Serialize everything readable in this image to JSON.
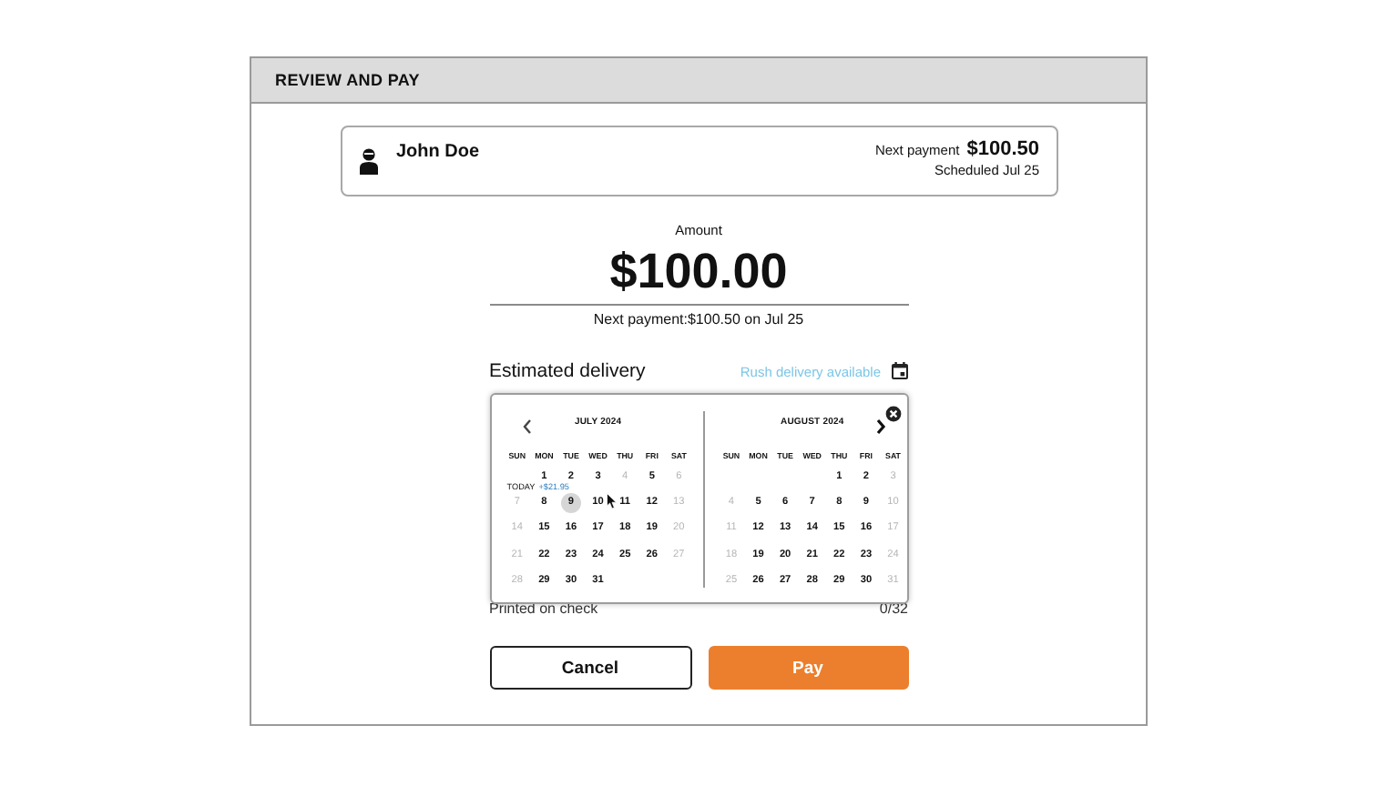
{
  "header": {
    "title": "REVIEW AND PAY"
  },
  "payee": {
    "name": "John Doe",
    "next_payment_label": "Next payment",
    "next_payment_amount": "$100.50",
    "scheduled": "Scheduled Jul 25"
  },
  "amount": {
    "label": "Amount",
    "value": "$100.00",
    "note": "Next payment:$100.50 on Jul 25"
  },
  "delivery": {
    "label": "Estimated delivery",
    "rush_link": "Rush delivery available"
  },
  "calendar": {
    "months": [
      {
        "title": "JULY 2024",
        "weekdays": [
          "SUN",
          "MON",
          "TUE",
          "WED",
          "THU",
          "FRI",
          "SAT"
        ],
        "weeks": [
          [
            {
              "kind": "blank"
            },
            {
              "kind": "day",
              "text": "1",
              "muted": false,
              "selected": false,
              "note_label": "TODAY",
              "note_amount": "+$21.95"
            },
            {
              "kind": "day",
              "text": "2",
              "muted": false,
              "selected": false
            },
            {
              "kind": "day",
              "text": "3",
              "muted": false,
              "selected": false
            },
            {
              "kind": "day",
              "text": "4",
              "muted": true,
              "selected": false
            },
            {
              "kind": "day",
              "text": "5",
              "muted": false,
              "selected": false
            },
            {
              "kind": "day",
              "text": "6",
              "muted": true,
              "selected": false
            }
          ],
          [
            {
              "kind": "day",
              "text": "7",
              "muted": true,
              "selected": false
            },
            {
              "kind": "day",
              "text": "8",
              "muted": false,
              "selected": false
            },
            {
              "kind": "day",
              "text": "9",
              "muted": false,
              "selected": true
            },
            {
              "kind": "day",
              "text": "10",
              "muted": false,
              "selected": false
            },
            {
              "kind": "day",
              "text": "11",
              "muted": false,
              "selected": false
            },
            {
              "kind": "day",
              "text": "12",
              "muted": false,
              "selected": false
            },
            {
              "kind": "day",
              "text": "13",
              "muted": true,
              "selected": false
            }
          ],
          [
            {
              "kind": "day",
              "text": "14",
              "muted": true,
              "selected": false
            },
            {
              "kind": "day",
              "text": "15",
              "muted": false,
              "selected": false
            },
            {
              "kind": "day",
              "text": "16",
              "muted": false,
              "selected": false
            },
            {
              "kind": "day",
              "text": "17",
              "muted": false,
              "selected": false
            },
            {
              "kind": "day",
              "text": "18",
              "muted": false,
              "selected": false
            },
            {
              "kind": "day",
              "text": "19",
              "muted": false,
              "selected": false
            },
            {
              "kind": "day",
              "text": "20",
              "muted": true,
              "selected": false
            }
          ],
          [
            {
              "kind": "day",
              "text": "21",
              "muted": true,
              "selected": false
            },
            {
              "kind": "day",
              "text": "22",
              "muted": false,
              "selected": false
            },
            {
              "kind": "day",
              "text": "23",
              "muted": false,
              "selected": false
            },
            {
              "kind": "day",
              "text": "24",
              "muted": false,
              "selected": false
            },
            {
              "kind": "day",
              "text": "25",
              "muted": false,
              "selected": false
            },
            {
              "kind": "day",
              "text": "26",
              "muted": false,
              "selected": false
            },
            {
              "kind": "day",
              "text": "27",
              "muted": true,
              "selected": false
            }
          ],
          [
            {
              "kind": "day",
              "text": "28",
              "muted": true,
              "selected": false
            },
            {
              "kind": "day",
              "text": "29",
              "muted": false,
              "selected": false
            },
            {
              "kind": "day",
              "text": "30",
              "muted": false,
              "selected": false
            },
            {
              "kind": "day",
              "text": "31",
              "muted": false,
              "selected": false
            }
          ]
        ]
      },
      {
        "title": "AUGUST 2024",
        "weekdays": [
          "SUN",
          "MON",
          "TUE",
          "WED",
          "THU",
          "FRI",
          "SAT"
        ],
        "weeks": [
          [
            {
              "kind": "blank"
            },
            {
              "kind": "blank"
            },
            {
              "kind": "blank"
            },
            {
              "kind": "blank"
            },
            {
              "kind": "day",
              "text": "1",
              "muted": false,
              "selected": false
            },
            {
              "kind": "day",
              "text": "2",
              "muted": false,
              "selected": false
            },
            {
              "kind": "day",
              "text": "3",
              "muted": true,
              "selected": false
            }
          ],
          [
            {
              "kind": "day",
              "text": "4",
              "muted": true,
              "selected": false
            },
            {
              "kind": "day",
              "text": "5",
              "muted": false,
              "selected": false
            },
            {
              "kind": "day",
              "text": "6",
              "muted": false,
              "selected": false
            },
            {
              "kind": "day",
              "text": "7",
              "muted": false,
              "selected": false
            },
            {
              "kind": "day",
              "text": "8",
              "muted": false,
              "selected": false
            },
            {
              "kind": "day",
              "text": "9",
              "muted": false,
              "selected": false
            },
            {
              "kind": "day",
              "text": "10",
              "muted": true,
              "selected": false
            }
          ],
          [
            {
              "kind": "day",
              "text": "11",
              "muted": true,
              "selected": false
            },
            {
              "kind": "day",
              "text": "12",
              "muted": false,
              "selected": false
            },
            {
              "kind": "day",
              "text": "13",
              "muted": false,
              "selected": false
            },
            {
              "kind": "day",
              "text": "14",
              "muted": false,
              "selected": false
            },
            {
              "kind": "day",
              "text": "15",
              "muted": false,
              "selected": false
            },
            {
              "kind": "day",
              "text": "16",
              "muted": false,
              "selected": false
            },
            {
              "kind": "day",
              "text": "17",
              "muted": true,
              "selected": false
            }
          ],
          [
            {
              "kind": "day",
              "text": "18",
              "muted": true,
              "selected": false
            },
            {
              "kind": "day",
              "text": "19",
              "muted": false,
              "selected": false
            },
            {
              "kind": "day",
              "text": "20",
              "muted": false,
              "selected": false
            },
            {
              "kind": "day",
              "text": "21",
              "muted": false,
              "selected": false
            },
            {
              "kind": "day",
              "text": "22",
              "muted": false,
              "selected": false
            },
            {
              "kind": "day",
              "text": "23",
              "muted": false,
              "selected": false
            },
            {
              "kind": "day",
              "text": "24",
              "muted": true,
              "selected": false
            }
          ],
          [
            {
              "kind": "day",
              "text": "25",
              "muted": true,
              "selected": false
            },
            {
              "kind": "day",
              "text": "26",
              "muted": false,
              "selected": false
            },
            {
              "kind": "day",
              "text": "27",
              "muted": false,
              "selected": false
            },
            {
              "kind": "day",
              "text": "28",
              "muted": false,
              "selected": false
            },
            {
              "kind": "day",
              "text": "29",
              "muted": false,
              "selected": false
            },
            {
              "kind": "day",
              "text": "30",
              "muted": false,
              "selected": false
            },
            {
              "kind": "day",
              "text": "31",
              "muted": true,
              "selected": false
            }
          ]
        ]
      }
    ]
  },
  "memo": {
    "label": "Printed on check",
    "counter": "0/32"
  },
  "buttons": [
    {
      "label": "Cancel",
      "kind": "secondary"
    },
    {
      "label": "Pay",
      "kind": "primary"
    }
  ]
}
